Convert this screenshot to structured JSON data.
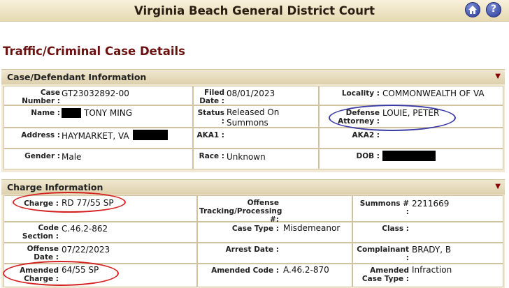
{
  "header": {
    "court_name": "Virginia Beach General District Court",
    "home_icon": "home-icon",
    "help_icon": "help-icon",
    "help_glyph": "?"
  },
  "page_title": "Traffic/Criminal Case Details",
  "case_section": {
    "title": "Case/Defendant Information",
    "arrow": "▼",
    "case_number_label": "Case Number :",
    "case_number": "GT23032892-00",
    "filed_date_label": "Filed Date :",
    "filed_date": "08/01/2023",
    "locality_label": "Locality :",
    "locality": "COMMONWEALTH OF VA",
    "name_label": "Name :",
    "name": "TONY MING",
    "status_label": "Status :",
    "status": "Released On Summons",
    "defense_label": "Defense Attorney :",
    "defense": "LOUIE, PETER",
    "address_label": "Address :",
    "address": "HAYMARKET, VA",
    "aka1_label": "AKA1 :",
    "aka1": "",
    "aka2_label": "AKA2 :",
    "aka2": "",
    "gender_label": "Gender :",
    "gender": "Male",
    "race_label": "Race :",
    "race": "Unknown",
    "dob_label": "DOB :",
    "dob": ""
  },
  "charge_section": {
    "title": "Charge Information",
    "arrow": "▼",
    "charge_label": "Charge :",
    "charge": "RD 77/55 SP",
    "tracking_label": "Offense Tracking/Processing #:",
    "tracking": "",
    "summons_label": "Summons # :",
    "summons": "2211669",
    "code_section_label": "Code Section :",
    "code_section": "C.46.2-862",
    "case_type_label": "Case Type :",
    "case_type": "Misdemeanor",
    "class_label": "Class :",
    "class": "",
    "offense_date_label": "Offense Date :",
    "offense_date": "07/22/2023",
    "arrest_date_label": "Arrest Date :",
    "arrest_date": "",
    "complainant_label": "Complainant :",
    "complainant": "BRADY, B",
    "amended_charge_label": "Amended Charge :",
    "amended_charge": "64/55 SP",
    "amended_code_label": "Amended Code :",
    "amended_code": "A.46.2-870",
    "amended_case_type_label": "Amended Case Type :",
    "amended_case_type": "Infraction"
  },
  "colors": {
    "title_red": "#6b1010",
    "annotation_red": "#d42020",
    "annotation_blue": "#3a3aa6"
  }
}
